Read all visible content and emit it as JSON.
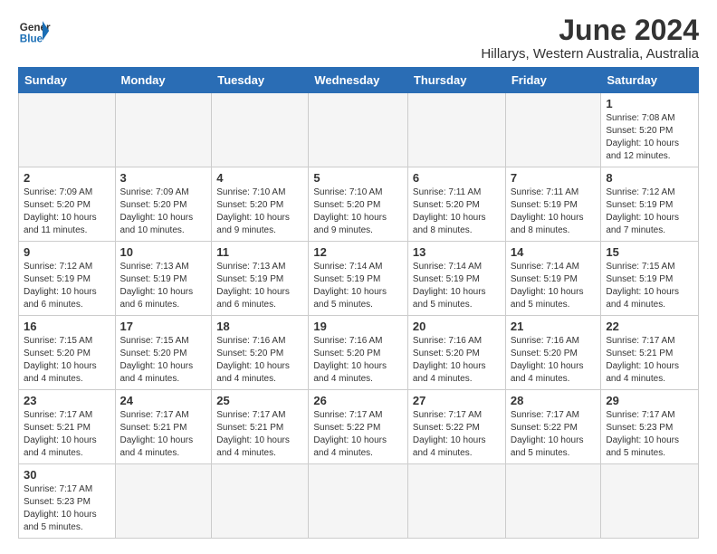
{
  "logo": {
    "text_general": "General",
    "text_blue": "Blue"
  },
  "title": "June 2024",
  "location": "Hillarys, Western Australia, Australia",
  "days_of_week": [
    "Sunday",
    "Monday",
    "Tuesday",
    "Wednesday",
    "Thursday",
    "Friday",
    "Saturday"
  ],
  "weeks": [
    [
      {
        "day": "",
        "info": ""
      },
      {
        "day": "",
        "info": ""
      },
      {
        "day": "",
        "info": ""
      },
      {
        "day": "",
        "info": ""
      },
      {
        "day": "",
        "info": ""
      },
      {
        "day": "",
        "info": ""
      },
      {
        "day": "1",
        "info": "Sunrise: 7:08 AM\nSunset: 5:20 PM\nDaylight: 10 hours and 12 minutes."
      }
    ],
    [
      {
        "day": "2",
        "info": "Sunrise: 7:09 AM\nSunset: 5:20 PM\nDaylight: 10 hours and 11 minutes."
      },
      {
        "day": "3",
        "info": "Sunrise: 7:09 AM\nSunset: 5:20 PM\nDaylight: 10 hours and 10 minutes."
      },
      {
        "day": "4",
        "info": "Sunrise: 7:10 AM\nSunset: 5:20 PM\nDaylight: 10 hours and 9 minutes."
      },
      {
        "day": "5",
        "info": "Sunrise: 7:10 AM\nSunset: 5:20 PM\nDaylight: 10 hours and 9 minutes."
      },
      {
        "day": "6",
        "info": "Sunrise: 7:11 AM\nSunset: 5:20 PM\nDaylight: 10 hours and 8 minutes."
      },
      {
        "day": "7",
        "info": "Sunrise: 7:11 AM\nSunset: 5:19 PM\nDaylight: 10 hours and 8 minutes."
      },
      {
        "day": "8",
        "info": "Sunrise: 7:12 AM\nSunset: 5:19 PM\nDaylight: 10 hours and 7 minutes."
      }
    ],
    [
      {
        "day": "9",
        "info": "Sunrise: 7:12 AM\nSunset: 5:19 PM\nDaylight: 10 hours and 6 minutes."
      },
      {
        "day": "10",
        "info": "Sunrise: 7:13 AM\nSunset: 5:19 PM\nDaylight: 10 hours and 6 minutes."
      },
      {
        "day": "11",
        "info": "Sunrise: 7:13 AM\nSunset: 5:19 PM\nDaylight: 10 hours and 6 minutes."
      },
      {
        "day": "12",
        "info": "Sunrise: 7:14 AM\nSunset: 5:19 PM\nDaylight: 10 hours and 5 minutes."
      },
      {
        "day": "13",
        "info": "Sunrise: 7:14 AM\nSunset: 5:19 PM\nDaylight: 10 hours and 5 minutes."
      },
      {
        "day": "14",
        "info": "Sunrise: 7:14 AM\nSunset: 5:19 PM\nDaylight: 10 hours and 5 minutes."
      },
      {
        "day": "15",
        "info": "Sunrise: 7:15 AM\nSunset: 5:19 PM\nDaylight: 10 hours and 4 minutes."
      }
    ],
    [
      {
        "day": "16",
        "info": "Sunrise: 7:15 AM\nSunset: 5:20 PM\nDaylight: 10 hours and 4 minutes."
      },
      {
        "day": "17",
        "info": "Sunrise: 7:15 AM\nSunset: 5:20 PM\nDaylight: 10 hours and 4 minutes."
      },
      {
        "day": "18",
        "info": "Sunrise: 7:16 AM\nSunset: 5:20 PM\nDaylight: 10 hours and 4 minutes."
      },
      {
        "day": "19",
        "info": "Sunrise: 7:16 AM\nSunset: 5:20 PM\nDaylight: 10 hours and 4 minutes."
      },
      {
        "day": "20",
        "info": "Sunrise: 7:16 AM\nSunset: 5:20 PM\nDaylight: 10 hours and 4 minutes."
      },
      {
        "day": "21",
        "info": "Sunrise: 7:16 AM\nSunset: 5:20 PM\nDaylight: 10 hours and 4 minutes."
      },
      {
        "day": "22",
        "info": "Sunrise: 7:17 AM\nSunset: 5:21 PM\nDaylight: 10 hours and 4 minutes."
      }
    ],
    [
      {
        "day": "23",
        "info": "Sunrise: 7:17 AM\nSunset: 5:21 PM\nDaylight: 10 hours and 4 minutes."
      },
      {
        "day": "24",
        "info": "Sunrise: 7:17 AM\nSunset: 5:21 PM\nDaylight: 10 hours and 4 minutes."
      },
      {
        "day": "25",
        "info": "Sunrise: 7:17 AM\nSunset: 5:21 PM\nDaylight: 10 hours and 4 minutes."
      },
      {
        "day": "26",
        "info": "Sunrise: 7:17 AM\nSunset: 5:22 PM\nDaylight: 10 hours and 4 minutes."
      },
      {
        "day": "27",
        "info": "Sunrise: 7:17 AM\nSunset: 5:22 PM\nDaylight: 10 hours and 4 minutes."
      },
      {
        "day": "28",
        "info": "Sunrise: 7:17 AM\nSunset: 5:22 PM\nDaylight: 10 hours and 5 minutes."
      },
      {
        "day": "29",
        "info": "Sunrise: 7:17 AM\nSunset: 5:23 PM\nDaylight: 10 hours and 5 minutes."
      }
    ],
    [
      {
        "day": "30",
        "info": "Sunrise: 7:17 AM\nSunset: 5:23 PM\nDaylight: 10 hours and 5 minutes."
      },
      {
        "day": "",
        "info": ""
      },
      {
        "day": "",
        "info": ""
      },
      {
        "day": "",
        "info": ""
      },
      {
        "day": "",
        "info": ""
      },
      {
        "day": "",
        "info": ""
      },
      {
        "day": "",
        "info": ""
      }
    ]
  ]
}
